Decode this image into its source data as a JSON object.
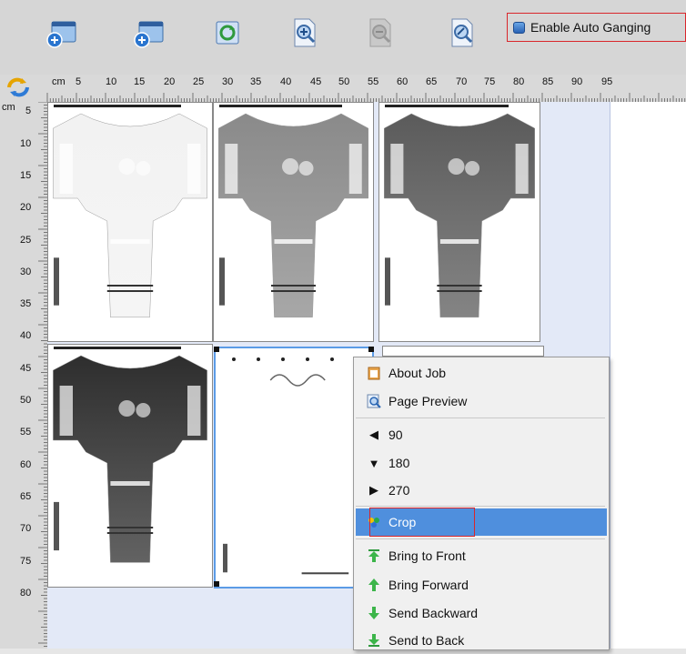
{
  "toolbar": {
    "buttons": [
      {
        "name": "add-job"
      },
      {
        "name": "add-job-alt"
      },
      {
        "name": "refresh"
      },
      {
        "name": "zoom-in"
      },
      {
        "name": "zoom-out"
      },
      {
        "name": "zoom-fit"
      }
    ],
    "auto_ganging_label": "Enable Auto Ganging",
    "auto_ganging_checked": true
  },
  "rulers": {
    "unit": "cm",
    "h_ticks": [
      "5",
      "10",
      "15",
      "20",
      "25",
      "30",
      "35",
      "40",
      "45",
      "50",
      "55",
      "60",
      "65",
      "70",
      "75",
      "80",
      "85",
      "90",
      "95"
    ],
    "v_ticks": [
      "5",
      "10",
      "15",
      "20",
      "25",
      "30",
      "35",
      "40",
      "45",
      "50",
      "55",
      "60",
      "65",
      "70",
      "75",
      "80"
    ]
  },
  "canvas": {
    "jobs": [
      {
        "name": "tee-1",
        "shade": "#f2f2f2"
      },
      {
        "name": "tee-2",
        "shade": "#8a8a8a"
      },
      {
        "name": "tee-3",
        "shade": "#5b5b5b"
      },
      {
        "name": "tee-4",
        "shade": "#2e2e2e"
      },
      {
        "name": "tee-5",
        "shade": "#ffffff"
      }
    ]
  },
  "context_menu": {
    "items": [
      {
        "label": "About Job",
        "icon": "clipboard-icon"
      },
      {
        "label": "Page Preview",
        "icon": "magnifier-icon"
      },
      {
        "label": "90",
        "icon": "arrow-left-icon"
      },
      {
        "label": "180",
        "icon": "arrow-down-icon"
      },
      {
        "label": "270",
        "icon": "arrow-right-icon"
      },
      {
        "label": "Crop",
        "icon": "crop-icon"
      },
      {
        "label": "Bring to Front",
        "icon": "bring-to-front-icon"
      },
      {
        "label": "Bring Forward",
        "icon": "bring-forward-icon"
      },
      {
        "label": "Send Backward",
        "icon": "send-backward-icon"
      },
      {
        "label": "Send to Back",
        "icon": "send-to-back-icon"
      }
    ],
    "highlighted": "Crop"
  },
  "colors": {
    "accent": "#4f8fdd",
    "highlight_border": "#d9262b",
    "sheet": "#e3e9f7"
  }
}
